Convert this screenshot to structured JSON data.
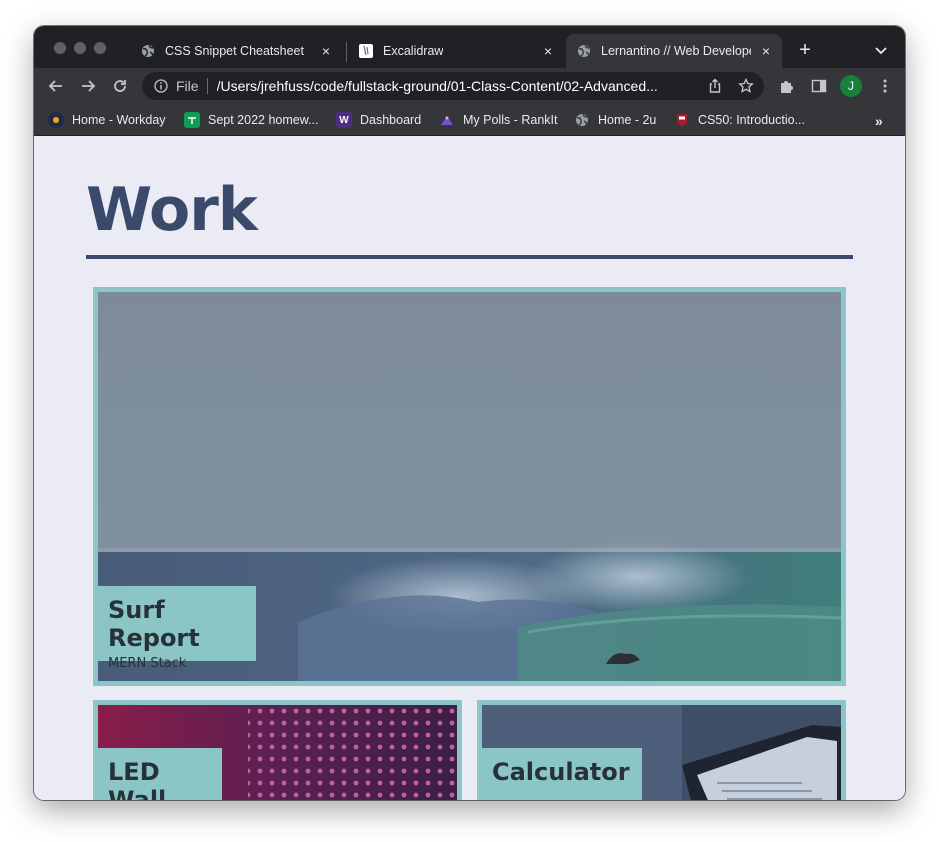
{
  "browser": {
    "tabs": [
      {
        "title": "CSS Snippet Cheatsheet",
        "icon": "globe-icon",
        "active": false
      },
      {
        "title": "Excalidraw",
        "icon": "excalidraw-icon",
        "active": false
      },
      {
        "title": "Lernantino // Web Develope",
        "icon": "globe-icon",
        "active": true
      }
    ],
    "close_glyph": "×",
    "new_tab_glyph": "+",
    "address": {
      "scheme_label": "File",
      "url": "/Users/jrehfuss/code/fullstack-ground/01-Class-Content/02-Advanced..."
    },
    "profile_initial": "J",
    "bookmarks": [
      {
        "label": "Home - Workday",
        "icon": "workday-icon"
      },
      {
        "label": "Sept 2022 homew...",
        "icon": "sheets-icon"
      },
      {
        "label": "Dashboard",
        "icon": "uw-icon",
        "icon_text": "W"
      },
      {
        "label": "My Polls - RankIt",
        "icon": "rankit-icon"
      },
      {
        "label": "Home - 2u",
        "icon": "globe-icon"
      },
      {
        "label": "CS50: Introductio...",
        "icon": "harvard-icon"
      }
    ],
    "bookmarks_overflow": "»"
  },
  "page": {
    "title": "Work",
    "projects": [
      {
        "name": "Surf Report",
        "tech": "MERN Stack"
      },
      {
        "name": "LED Wall",
        "tech": ""
      },
      {
        "name": "Calculator",
        "tech": ""
      }
    ]
  },
  "colors": {
    "heading": "#3b4a6b",
    "card_accent": "#8cc5c5",
    "page_bg": "#ebebf5",
    "chrome_dark": "#202124",
    "chrome_toolbar": "#35363a"
  }
}
